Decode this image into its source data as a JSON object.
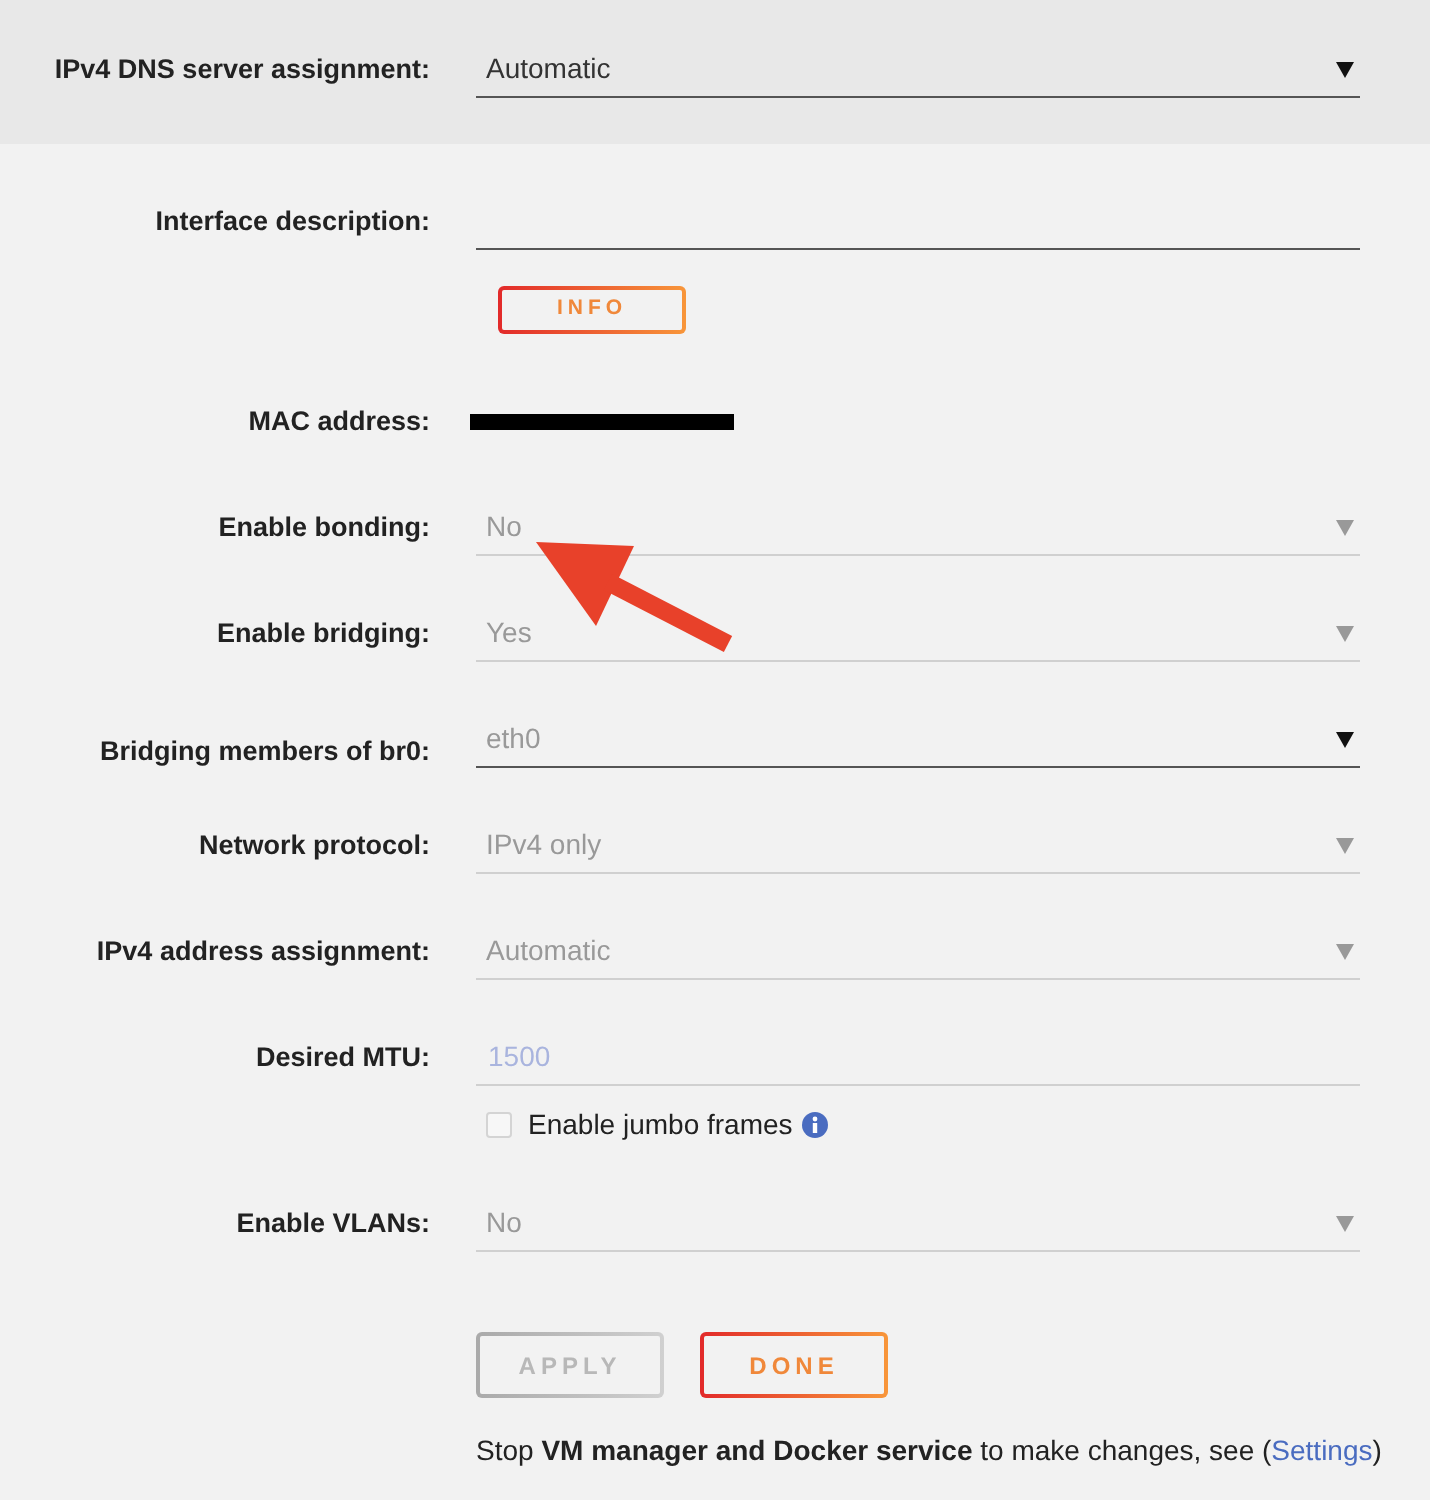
{
  "dns_section": {
    "label": "IPv4 DNS server assignment:",
    "value": "Automatic",
    "disabled": false
  },
  "rows": [
    {
      "kind": "input",
      "label": "Interface description:",
      "disabled": false
    },
    {
      "kind": "button",
      "label": "INFO"
    },
    {
      "kind": "redacted",
      "label": "MAC address:"
    },
    {
      "kind": "select",
      "label": "Enable bonding:",
      "value": "No",
      "disabled": true
    },
    {
      "kind": "select",
      "label": "Enable bridging:",
      "value": "Yes",
      "disabled": true
    },
    {
      "kind": "multiselect",
      "label": "Bridging members of br0:",
      "value": "eth0"
    },
    {
      "kind": "select",
      "label": "Network protocol:",
      "value": "IPv4 only",
      "disabled": true
    },
    {
      "kind": "select",
      "label": "IPv4 address assignment:",
      "value": "Automatic",
      "disabled": true
    },
    {
      "kind": "input",
      "label": "Desired MTU:",
      "value": "1500",
      "disabled": true
    },
    {
      "kind": "checkbox",
      "label": "Enable jumbo frames",
      "checked": false
    },
    {
      "kind": "select",
      "label": "Enable VLANs:",
      "value": "No",
      "disabled": true
    }
  ],
  "buttons": [
    {
      "label": "APPLY",
      "disabled": true
    },
    {
      "label": "DONE",
      "disabled": false
    }
  ],
  "note": {
    "text": "Stop **VM manager and Docker service** to make changes, see (",
    "link": "Settings",
    "after": ")"
  }
}
